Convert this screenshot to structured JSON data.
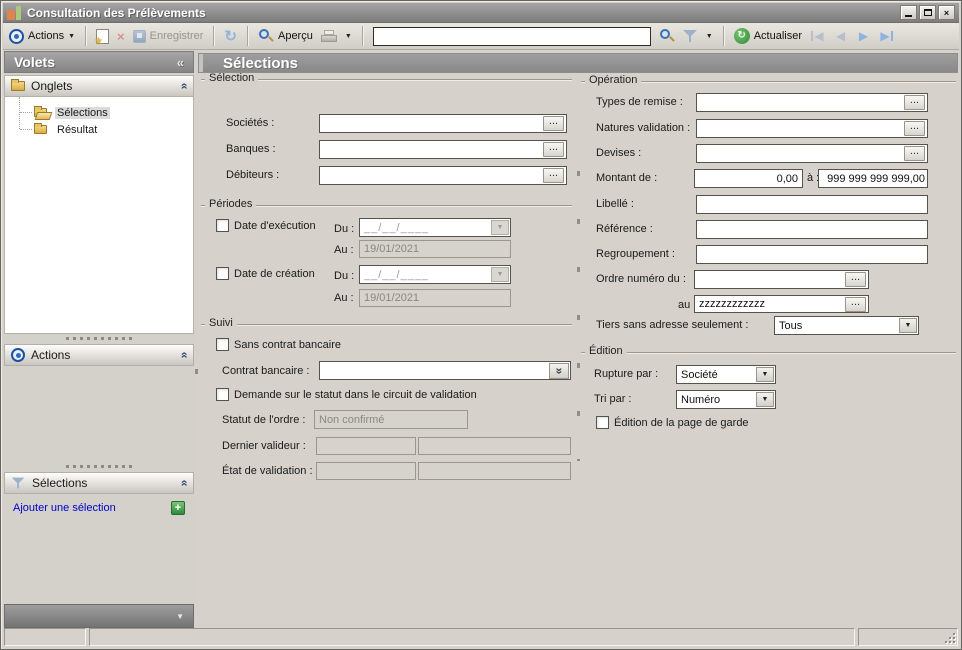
{
  "window": {
    "title": "Consultation des Prélèvements"
  },
  "icons": {
    "close": "×",
    "caret_down": "▼",
    "collapse_left": "«",
    "chevron_double": "»",
    "ellipsis": "...",
    "plus": "+",
    "refresh": "↻",
    "sync": "↻",
    "nav_prev": "◀",
    "nav_next": "▶",
    "delete_x": "×",
    "star": "★"
  },
  "colors": {
    "titlebar": "#8d8d8d",
    "panel_header": "#909090",
    "link": "#0000cc",
    "folder": "#e3b94e",
    "add_button_green": "#3f9e4d",
    "disabled_text": "#8b8880",
    "nav_enabled_blue": "#8fb2e0",
    "nav_disabled_blue": "#b6bfcd"
  },
  "toolbar": {
    "actions_label": "Actions",
    "save_label": "Enregistrer",
    "preview_label": "Aperçu",
    "refresh_label": "Actualiser",
    "search_value": ""
  },
  "sidebar": {
    "title": "Volets",
    "onglets": {
      "label": "Onglets",
      "items": [
        {
          "label": "Sélections"
        },
        {
          "label": "Résultat"
        }
      ]
    },
    "actions": {
      "label": "Actions"
    },
    "selections": {
      "label": "Sélections",
      "add_label": "Ajouter une sélection"
    }
  },
  "main": {
    "title": "Sélections",
    "selection": {
      "label": "Sélection",
      "societes_label": "Sociétés :",
      "banques_label": "Banques :",
      "debiteurs_label": "Débiteurs :"
    },
    "periodes": {
      "label": "Périodes",
      "exec_label": "Date d'exécution",
      "creation_label": "Date de création",
      "du_label": "Du :",
      "au_label": "Au :",
      "date_mask": "__/__/____",
      "exec_au_value": "19/01/2021",
      "creation_au_value": "19/01/2021"
    },
    "suivi": {
      "label": "Suivi",
      "sans_contrat_label": "Sans contrat bancaire",
      "contrat_label": "Contrat bancaire :",
      "demande_label": "Demande sur le statut dans le circuit de validation",
      "statut_label": "Statut de l'ordre :",
      "statut_value": "Non confirmé",
      "valideur_label": "Dernier valideur :",
      "etat_label": "État de validation :"
    },
    "operation": {
      "label": "Opération",
      "types_label": "Types de remise :",
      "natures_label": "Natures validation :",
      "devises_label": "Devises :",
      "montant_label": "Montant de :",
      "montant_min": "0,00",
      "a_label": "à :",
      "montant_max": "999 999 999 999,00",
      "libelle_label": "Libellé :",
      "reference_label": "Référence :",
      "regroupement_label": "Regroupement :",
      "ordre_du_label": "Ordre numéro du :",
      "ordre_au_label": "au :",
      "ordre_au_value": "zzzzzzzzzzzz",
      "tiers_label": "Tiers sans adresse seulement :",
      "tiers_value": "Tous"
    },
    "edition": {
      "label": "Édition",
      "rupture_label": "Rupture par :",
      "rupture_value": "Société",
      "tri_label": "Tri par :",
      "tri_value": "Numéro",
      "page_garde_label": "Édition de la page de garde"
    }
  }
}
